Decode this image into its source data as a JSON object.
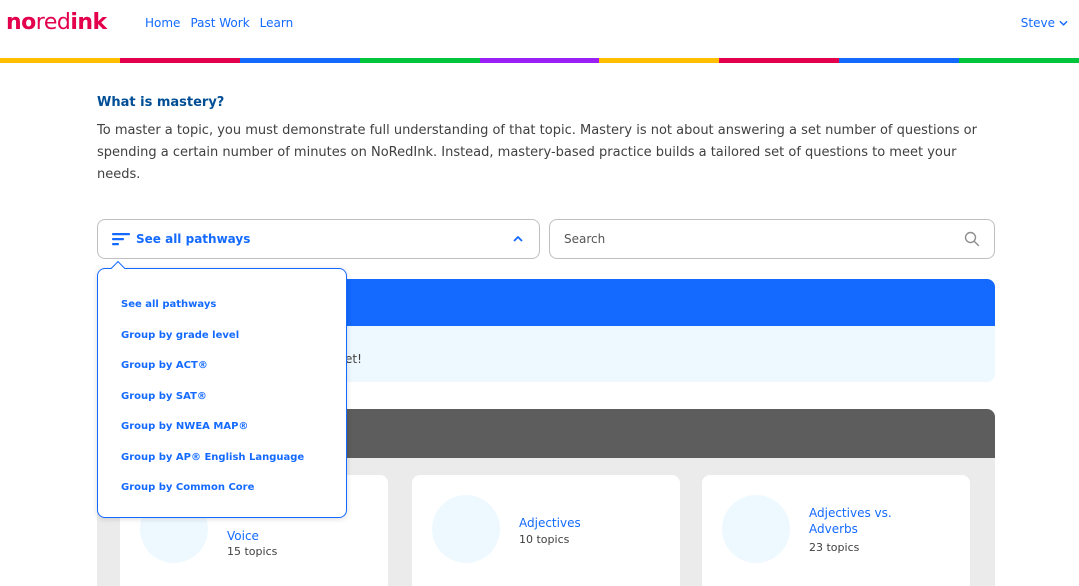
{
  "header": {
    "logo": {
      "part1": "no",
      "part2": "red",
      "part3": "ink"
    },
    "nav": [
      {
        "label": "Home"
      },
      {
        "label": "Past Work"
      },
      {
        "label": "Learn"
      }
    ],
    "user": {
      "name": "Steve"
    }
  },
  "colors": {
    "brand": "#e3004c",
    "link": "#146aff",
    "heading": "#004e95",
    "rainbow": [
      "#ffbe00",
      "#e3004c",
      "#146aff",
      "#00c53d",
      "#9a20f5",
      "#ffbe00",
      "#e3004c",
      "#146aff",
      "#00c53d"
    ]
  },
  "intro": {
    "title": "What is mastery?",
    "text": "To master a topic, you must demonstrate full understanding of that topic. Mastery is not about answering a set number of questions or spending a certain number of minutes on NoRedInk. Instead, mastery-based practice builds a tailored set of questions to meet your needs."
  },
  "filter": {
    "selected": "See all pathways",
    "options": [
      "See all pathways",
      "Group by grade level",
      "Group by ACT®",
      "Group by SAT®",
      "Group by NWEA MAP®",
      "Group by AP® English Language",
      "Group by Common Core"
    ]
  },
  "search": {
    "placeholder": "Search"
  },
  "banner": {
    "message_fragment": "et!"
  },
  "cards": [
    {
      "title_visible": "e",
      "title_line2": "Voice",
      "count": "15 topics"
    },
    {
      "title": "Adjectives",
      "count": "10 topics"
    },
    {
      "title": "Adjectives vs. Adverbs",
      "count": "23 topics"
    }
  ]
}
